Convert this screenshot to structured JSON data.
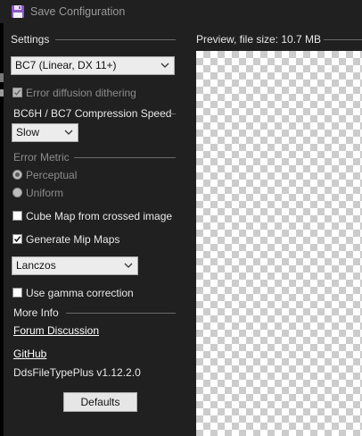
{
  "window": {
    "title": "Save Configuration",
    "icon": "floppy-disk-icon"
  },
  "settings": {
    "group_title": "Settings",
    "format_select": {
      "value": "BC7 (Linear, DX 11+)"
    },
    "error_diffusion": {
      "label": "Error diffusion dithering",
      "checked": true,
      "enabled": false
    },
    "compression_speed": {
      "group_title": "BC6H / BC7 Compression Speed",
      "select": {
        "value": "Slow"
      }
    },
    "error_metric": {
      "group_title": "Error Metric",
      "options": [
        {
          "label": "Perceptual",
          "selected": true
        },
        {
          "label": "Uniform",
          "selected": false
        }
      ]
    },
    "cube_map": {
      "label": "Cube Map from crossed image",
      "checked": false
    },
    "mip_maps": {
      "label": "Generate Mip Maps",
      "checked": true
    },
    "resample_select": {
      "value": "Lanczos"
    },
    "gamma": {
      "label": "Use gamma correction",
      "checked": false
    },
    "more_info": {
      "group_title": "More Info",
      "forum_link": "Forum Discussion",
      "github_link": "GitHub",
      "version": "DdsFileTypePlus v1.12.2.0"
    },
    "defaults_button": "Defaults"
  },
  "preview": {
    "title": "Preview, file size: 10.7 MB"
  },
  "colors": {
    "background": "#202020",
    "checker_dark": "#cccccc",
    "checker_light": "#ffffff"
  }
}
